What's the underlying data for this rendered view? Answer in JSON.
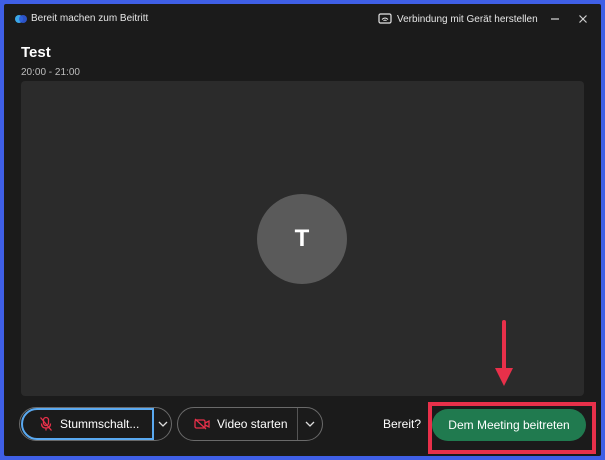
{
  "window": {
    "title": "Bereit machen zum Beitritt",
    "connect_label": "Verbindung mit Gerät herstellen"
  },
  "meeting": {
    "title": "Test",
    "time": "20:00 - 21:00",
    "avatar_initial": "T"
  },
  "controls": {
    "mute_label": "Stummschalt...",
    "video_label": "Video starten",
    "ready_label": "Bereit?",
    "join_label": "Dem Meeting beitreten"
  },
  "colors": {
    "join_button": "#207a4f",
    "annotation": "#e8304a",
    "focus_ring": "#5aa9f0",
    "frame": "#3f5fe6"
  }
}
